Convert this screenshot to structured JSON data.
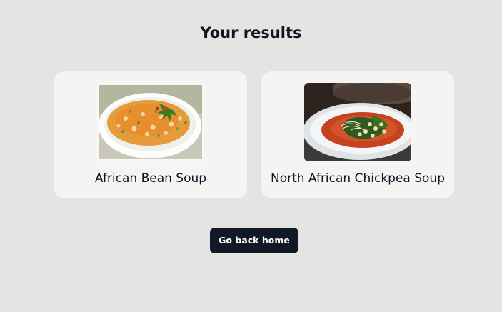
{
  "page": {
    "title": "Your results"
  },
  "results": [
    {
      "name": "African Bean Soup",
      "image": "african-bean-soup-photo"
    },
    {
      "name": "North African Chickpea Soup",
      "image": "north-african-chickpea-soup-photo"
    }
  ],
  "actions": {
    "home_label": "Go back home"
  },
  "colors": {
    "background": "#e6e4e3",
    "card": "#f4f4f2",
    "button": "#111827",
    "button_text": "#ffffff",
    "text": "#0f1422"
  }
}
